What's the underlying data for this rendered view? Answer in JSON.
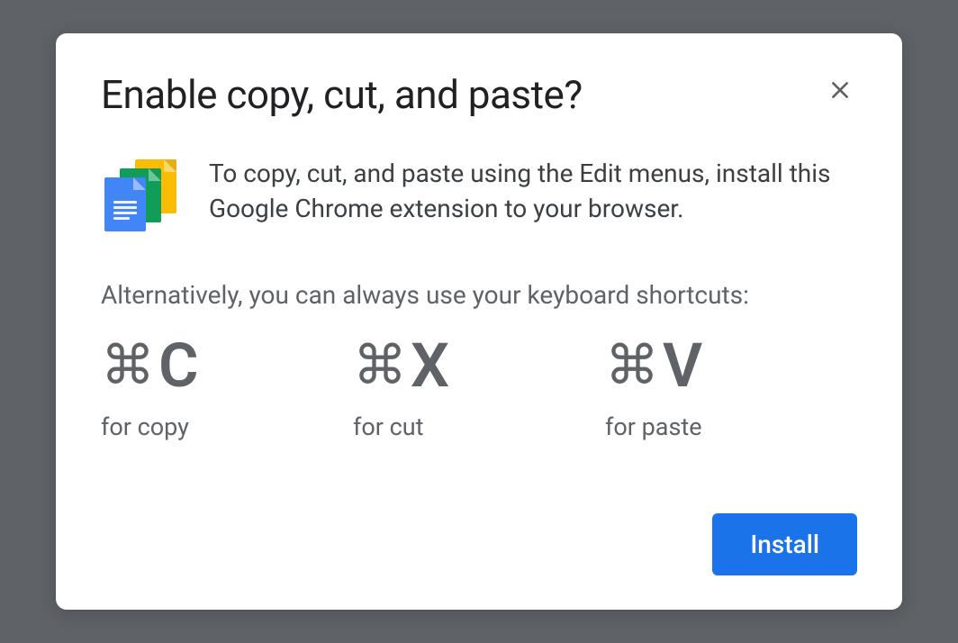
{
  "dialog": {
    "title": "Enable copy, cut, and paste?",
    "intro": "To copy, cut, and paste using the Edit menus, install this Google Chrome extension to your browser.",
    "alternative": "Alternatively, you can always use your keyboard shortcuts:",
    "shortcuts": [
      {
        "key": "C",
        "label": "for copy"
      },
      {
        "key": "X",
        "label": "for cut"
      },
      {
        "key": "V",
        "label": "for paste"
      }
    ],
    "install_label": "Install"
  }
}
